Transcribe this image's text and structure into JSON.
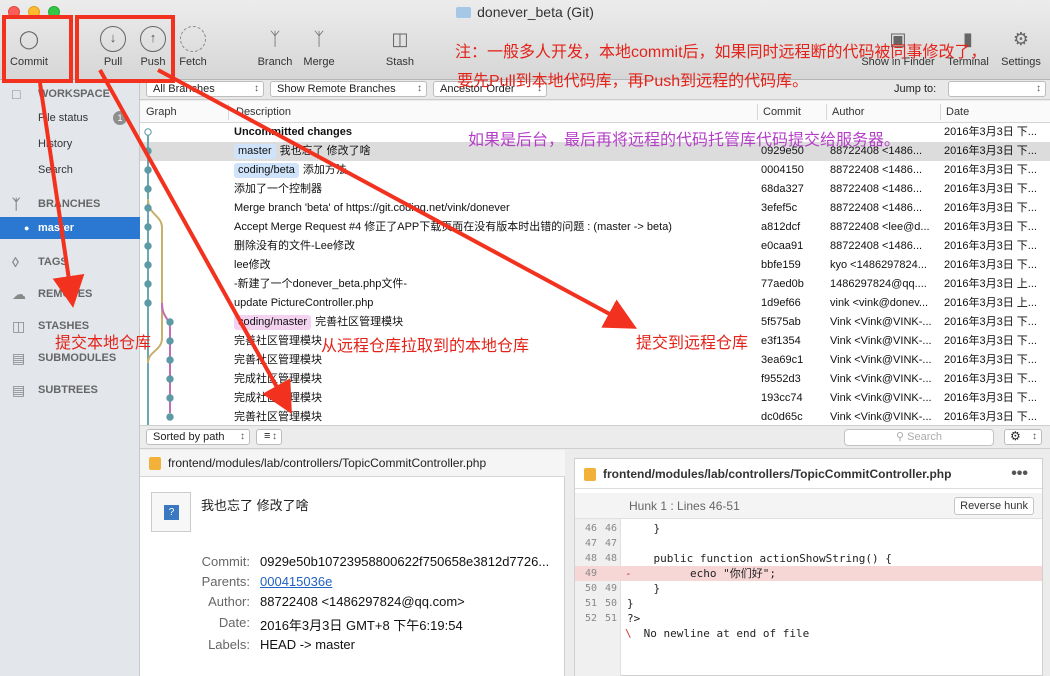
{
  "window": {
    "title": "donever_beta (Git)"
  },
  "toolbar": {
    "commit": "Commit",
    "pull": "Pull",
    "push": "Push",
    "fetch": "Fetch",
    "branch": "Branch",
    "merge": "Merge",
    "stash": "Stash",
    "show_in_finder": "Show in Finder",
    "terminal": "Terminal",
    "settings": "Settings"
  },
  "filterbar": {
    "branches": "All Branches",
    "remote": "Show Remote Branches",
    "order": "Ancestor Order",
    "jump_to": "Jump to:"
  },
  "sidebar": {
    "workspace": "WORKSPACE",
    "file_status": "File status",
    "file_status_count": "1",
    "history": "History",
    "search": "Search",
    "branches": "BRANCHES",
    "master": "master",
    "tags": "TAGS",
    "remotes": "REMOTES",
    "stashes": "STASHES",
    "submodules": "SUBMODULES",
    "subtrees": "SUBTREES"
  },
  "table": {
    "headers": {
      "graph": "Graph",
      "description": "Description",
      "commit": "Commit",
      "author": "Author",
      "date": "Date"
    },
    "rows": [
      {
        "tag": "",
        "desc": "Uncommitted changes",
        "commit": "",
        "author": "",
        "date": "2016年3月3日 下..."
      },
      {
        "tag": "master",
        "desc": "我也忘了 修改了啥",
        "commit": "0929e50",
        "author": "88722408 <1486...",
        "date": "2016年3月3日 下..."
      },
      {
        "tag": "coding/beta",
        "desc": "添加方法",
        "commit": "0004150",
        "author": "88722408 <1486...",
        "date": "2016年3月3日 下..."
      },
      {
        "tag": "",
        "desc": "添加了一个控制器",
        "commit": "68da327",
        "author": "88722408 <1486...",
        "date": "2016年3月3日 下..."
      },
      {
        "tag": "",
        "desc": "Merge branch 'beta' of https://git.coding.net/vink/donever",
        "commit": "3efef5c",
        "author": "88722408 <1486...",
        "date": "2016年3月3日 下..."
      },
      {
        "tag": "",
        "desc": "Accept Merge Request #4 修正了APP下载页面在没有版本时出错的问题 : (master -> beta)",
        "commit": "a812dcf",
        "author": "88722408 <lee@d...",
        "date": "2016年3月3日 下..."
      },
      {
        "tag": "",
        "desc": "删除没有的文件-Lee修改",
        "commit": "e0caa91",
        "author": "88722408 <1486...",
        "date": "2016年3月3日 下..."
      },
      {
        "tag": "",
        "desc": "lee修改",
        "commit": "bbfe159",
        "author": "kyo <1486297824...",
        "date": "2016年3月3日 下..."
      },
      {
        "tag": "",
        "desc": "-新建了一个donever_beta.php文件-",
        "commit": "77aed0b",
        "author": "1486297824@qq....",
        "date": "2016年3月3日 上..."
      },
      {
        "tag": "",
        "desc": "update PictureController.php",
        "commit": "1d9ef66",
        "author": "vink <vink@donev...",
        "date": "2016年3月3日 上..."
      },
      {
        "tag": "coding/master",
        "desc": "完善社区管理模块",
        "commit": "5f575ab",
        "author": "Vink <Vink@VINK-...",
        "date": "2016年3月3日 下..."
      },
      {
        "tag": "",
        "desc": "完善社区管理模块",
        "commit": "e3f1354",
        "author": "Vink <Vink@VINK-...",
        "date": "2016年3月3日 下..."
      },
      {
        "tag": "",
        "desc": "完善社区管理模块",
        "commit": "3ea69c1",
        "author": "Vink <Vink@VINK-...",
        "date": "2016年3月3日 下..."
      },
      {
        "tag": "",
        "desc": "完成社区管理模块",
        "commit": "f9552d3",
        "author": "Vink <Vink@VINK-...",
        "date": "2016年3月3日 下..."
      },
      {
        "tag": "",
        "desc": "完成社区管理模块",
        "commit": "193cc74",
        "author": "Vink <Vink@VINK-...",
        "date": "2016年3月3日 下..."
      },
      {
        "tag": "",
        "desc": "完善社区管理模块",
        "commit": "dc0d65c",
        "author": "Vink <Vink@VINK-...",
        "date": "2016年3月3日 下..."
      }
    ]
  },
  "listbar": {
    "sort": "Sorted by path",
    "search_placeholder": "Search"
  },
  "details": {
    "file": "frontend/modules/lab/controllers/TopicCommitController.php",
    "message": "我也忘了 修改了啥",
    "labels": {
      "commit": "Commit:",
      "parents": "Parents:",
      "author": "Author:",
      "date": "Date:",
      "labels": "Labels:"
    },
    "commit": "0929e50b10723958800622f750658e3812d7726...",
    "parents": "000415036e",
    "author": "88722408 <1486297824@qq.com>",
    "date": "2016年3月3日 GMT+8 下午6:19:54",
    "tags": "HEAD -> master"
  },
  "diff": {
    "file": "frontend/modules/lab/controllers/TopicCommitController.php",
    "hunk": "Hunk 1 : Lines 46-51",
    "reverse": "Reverse hunk",
    "lines": [
      {
        "a": "46",
        "b": "46",
        "sign": "",
        "code": "    }"
      },
      {
        "a": "47",
        "b": "47",
        "sign": "",
        "code": ""
      },
      {
        "a": "48",
        "b": "48",
        "sign": "",
        "code": "    public function actionShowString() {"
      },
      {
        "a": "49",
        "b": "",
        "sign": "-",
        "code": "        echo \"你们好\";"
      },
      {
        "a": "50",
        "b": "49",
        "sign": "",
        "code": "    }"
      },
      {
        "a": "51",
        "b": "50",
        "sign": "",
        "code": "}"
      },
      {
        "a": "52",
        "b": "51",
        "sign": "",
        "code": "?>"
      },
      {
        "a": "",
        "b": "",
        "sign": "\\",
        "code": " No newline at end of file"
      }
    ]
  },
  "annotations": {
    "note1": "注：一般多人开发，本地commit后，如果同时远程断的代码被同事修改了，",
    "note2": "要先Pull到本地代码库，再Push到远程的代码库。",
    "note3": "如果是后台，最后再将远程的代码托管库代码提交给服务器。",
    "commit_local": "提交本地仓库",
    "pull_remote": "从远程仓库拉取到的本地仓库",
    "push_remote": "提交到远程仓库"
  },
  "colors": {
    "accent": "#2a78d2",
    "annotation_red": "#f2321e",
    "annotation_purple": "#b43ec7"
  }
}
